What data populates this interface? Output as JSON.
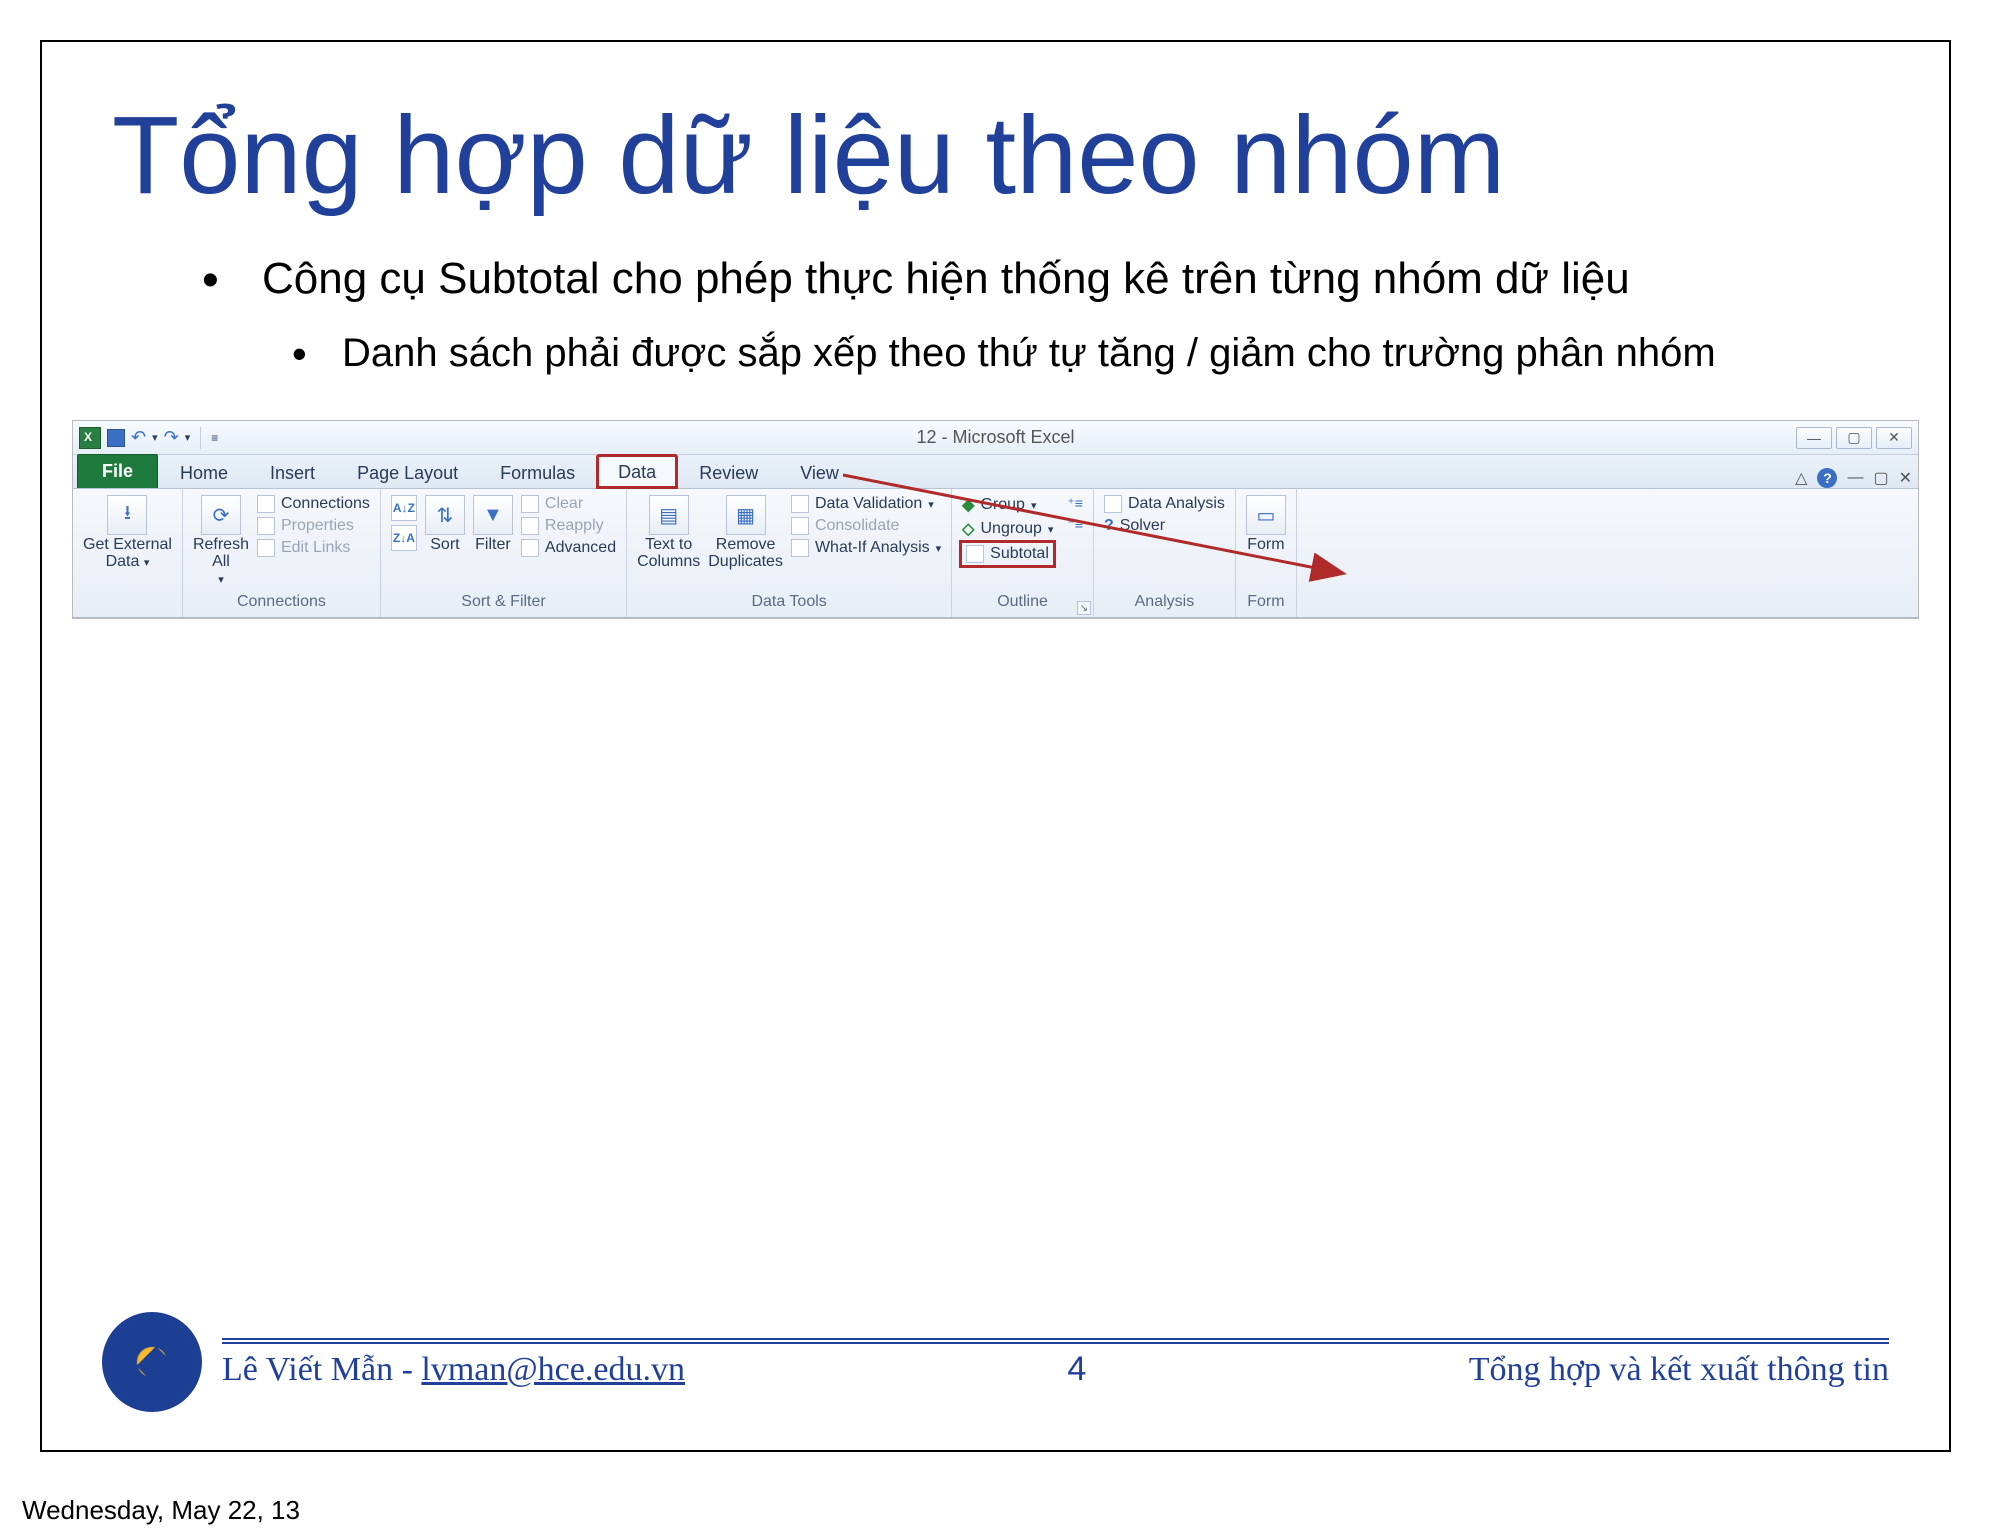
{
  "slide": {
    "title": "Tổng hợp dữ liệu theo nhóm",
    "bullets": {
      "l1": "Công cụ Subtotal cho phép thực hiện thống kê trên từng nhóm dữ liệu",
      "l2": "Danh sách phải được sắp xếp theo thứ tự tăng / giảm cho trường phân nhóm"
    }
  },
  "excel": {
    "window_title": "12 - Microsoft Excel",
    "tabs": {
      "file": "File",
      "home": "Home",
      "insert": "Insert",
      "page_layout": "Page Layout",
      "formulas": "Formulas",
      "data": "Data",
      "review": "Review",
      "view": "View"
    },
    "groups": {
      "get_external": {
        "label": "",
        "btn": "Get External\nData",
        "arrow": "▾"
      },
      "connections": {
        "label": "Connections",
        "refresh": "Refresh\nAll",
        "conn": "Connections",
        "props": "Properties",
        "links": "Edit Links"
      },
      "sortfilter": {
        "label": "Sort & Filter",
        "sort": "Sort",
        "filter": "Filter",
        "clear": "Clear",
        "reapply": "Reapply",
        "advanced": "Advanced"
      },
      "datatools": {
        "label": "Data Tools",
        "text_to_cols": "Text to\nColumns",
        "remove_dups": "Remove\nDuplicates",
        "validation": "Data Validation",
        "consolidate": "Consolidate",
        "whatif": "What-If Analysis"
      },
      "outline": {
        "label": "Outline",
        "group": "Group",
        "ungroup": "Ungroup",
        "subtotal": "Subtotal"
      },
      "analysis": {
        "label": "Analysis",
        "data_analysis": "Data Analysis",
        "solver": "Solver"
      },
      "form": {
        "label": "Form",
        "form": "Form"
      }
    }
  },
  "footer": {
    "author_name": "Lê Viết Mẫn - ",
    "author_email": "lvman@hce.edu.vn",
    "page": "4",
    "topic": "Tổng hợp và kết xuất thông tin"
  },
  "date_note": "Wednesday, May 22, 13"
}
